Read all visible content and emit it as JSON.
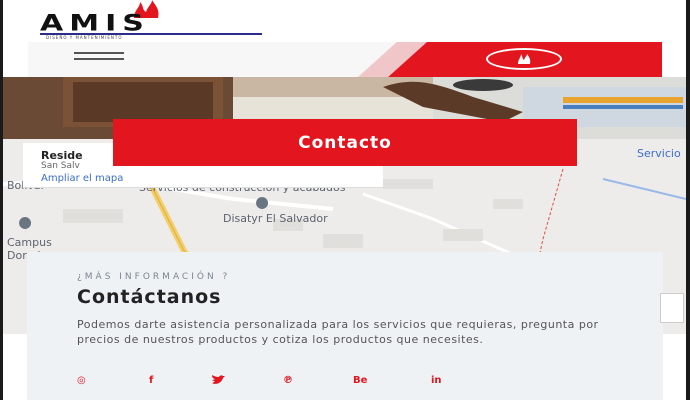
{
  "header": {
    "logo_text": "AMIS",
    "logo_tagline": "DISEÑO Y MANTENIMIENTO"
  },
  "nav": {
    "menu_icon": "hamburger-icon",
    "circle_icon": "flame-icon"
  },
  "map": {
    "place_title": "Reside",
    "place_subtitle": "San Salv",
    "expand_link": "Ampliar el mapa",
    "labels": {
      "bolivar": "Bolívar",
      "construccion": "Servicios de construcción y acabados",
      "disatyr": "Disatyr El Salvador",
      "campus": "Campus Dorados",
      "servicio": "Servicio"
    }
  },
  "banner": {
    "title": "Contacto"
  },
  "info": {
    "eyebrow": "¿MÁS INFORMACIÓN ?",
    "title": "Contáctanos",
    "text": "Podemos darte asistencia personalizada para los servicios que requieras, pregunta por precios de nuestros productos y cotiza los productos que necesites."
  },
  "social": [
    {
      "name": "instagram-icon",
      "glyph": "◎"
    },
    {
      "name": "facebook-icon",
      "glyph": "f"
    },
    {
      "name": "twitter-icon",
      "glyph": "🐦"
    },
    {
      "name": "pinterest-icon",
      "glyph": "℗"
    },
    {
      "name": "behance-icon",
      "glyph": "Be"
    },
    {
      "name": "linkedin-icon",
      "glyph": "in"
    }
  ],
  "colors": {
    "brand_red": "#e3151f",
    "text_dark": "#222222",
    "card_bg": "#eef2f5"
  }
}
